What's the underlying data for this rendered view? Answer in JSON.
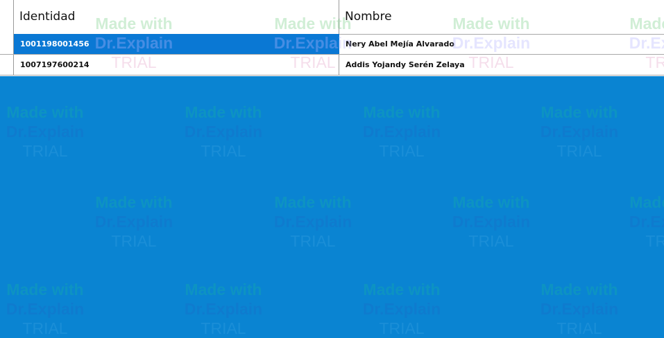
{
  "grid": {
    "columns": [
      {
        "label": "Identidad"
      },
      {
        "label": "Nombre"
      }
    ],
    "rows": [
      {
        "identidad": "1001198001456",
        "nombre": "Nery Abel Mejía Alvarado",
        "selected": true
      },
      {
        "identidad": "1007197600214",
        "nombre": "Addis Yojandy Serén Zelaya",
        "selected": false
      }
    ]
  },
  "watermark": {
    "line1": "Made with",
    "line2": "Dr.Explain",
    "line3": "TRIAL"
  },
  "colors": {
    "background": "#0a84d2",
    "selection": "#0a78d4"
  }
}
